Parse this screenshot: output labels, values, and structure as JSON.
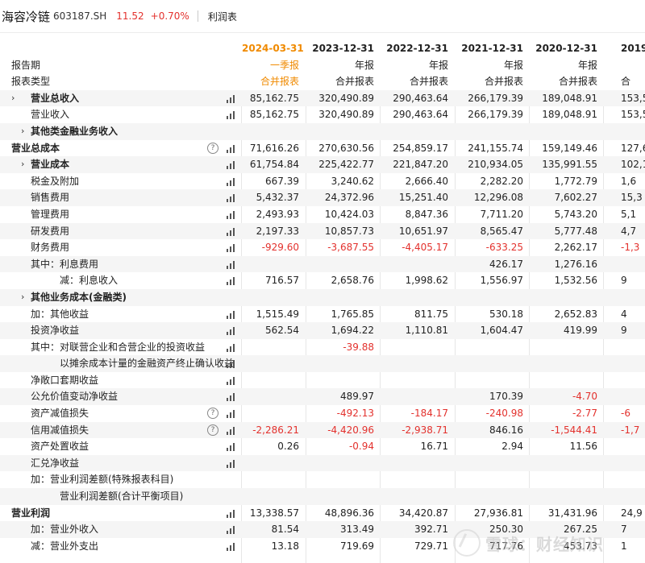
{
  "header": {
    "name": "海容冷链",
    "code": "603187.SH",
    "price": "11.52",
    "change": "+0.70%",
    "tab": "利润表"
  },
  "columns": [
    {
      "date": "2024-03-31",
      "period": "一季报",
      "type": "合并报表",
      "highlight": true
    },
    {
      "date": "2023-12-31",
      "period": "年报",
      "type": "合并报表"
    },
    {
      "date": "2022-12-31",
      "period": "年报",
      "type": "合并报表"
    },
    {
      "date": "2021-12-31",
      "period": "年报",
      "type": "合并报表"
    },
    {
      "date": "2020-12-31",
      "period": "年报",
      "type": "合并报表"
    },
    {
      "date": "2019-",
      "period": "",
      "type": "合"
    }
  ],
  "header_labels": {
    "period_label": "报告期",
    "type_label": "报表类型"
  },
  "rows": [
    {
      "label": "营业总收入",
      "indent": 1,
      "bold": true,
      "expand": true,
      "chart": true,
      "values": [
        "85,162.75",
        "320,490.89",
        "290,463.64",
        "266,179.39",
        "189,048.91",
        "153,5"
      ]
    },
    {
      "label": "营业收入",
      "indent": 2,
      "chart": true,
      "values": [
        "85,162.75",
        "320,490.89",
        "290,463.64",
        "266,179.39",
        "189,048.91",
        "153,5"
      ]
    },
    {
      "label": "其他类金融业务收入",
      "indent": 2,
      "bold": true,
      "expand": true,
      "values": [
        "",
        "",
        "",
        "",
        "",
        ""
      ]
    },
    {
      "label": "营业总成本",
      "indent": 0,
      "bold": true,
      "help": true,
      "chart": true,
      "values": [
        "71,616.26",
        "270,630.56",
        "254,859.17",
        "241,155.74",
        "159,149.46",
        "127,6"
      ]
    },
    {
      "label": "营业成本",
      "indent": 2,
      "bold": true,
      "expand": true,
      "chart": true,
      "values": [
        "61,754.84",
        "225,422.77",
        "221,847.20",
        "210,934.05",
        "135,991.55",
        "102,1"
      ]
    },
    {
      "label": "税金及附加",
      "indent": 2,
      "chart": true,
      "values": [
        "667.39",
        "3,240.62",
        "2,666.40",
        "2,282.20",
        "1,772.79",
        "1,6"
      ]
    },
    {
      "label": "销售费用",
      "indent": 2,
      "chart": true,
      "values": [
        "5,432.37",
        "24,372.96",
        "15,251.40",
        "12,296.08",
        "7,602.27",
        "15,3"
      ]
    },
    {
      "label": "管理费用",
      "indent": 2,
      "chart": true,
      "values": [
        "2,493.93",
        "10,424.03",
        "8,847.36",
        "7,711.20",
        "5,743.20",
        "5,1"
      ]
    },
    {
      "label": "研发费用",
      "indent": 2,
      "chart": true,
      "values": [
        "2,197.33",
        "10,857.73",
        "10,651.97",
        "8,565.47",
        "5,777.48",
        "4,7"
      ]
    },
    {
      "label": "财务费用",
      "indent": 2,
      "chart": true,
      "values": [
        "-929.60",
        "-3,687.55",
        "-4,405.17",
        "-633.25",
        "2,262.17",
        "-1,3"
      ]
    },
    {
      "label": "其中：利息费用",
      "indent": 2,
      "chart": true,
      "values": [
        "",
        "",
        "",
        "426.17",
        "1,276.16",
        ""
      ]
    },
    {
      "label": "减：利息收入",
      "indent": 3,
      "chart": true,
      "values": [
        "716.57",
        "2,658.76",
        "1,998.62",
        "1,556.97",
        "1,532.56",
        "9"
      ]
    },
    {
      "label": "其他业务成本(金融类)",
      "indent": 2,
      "bold": true,
      "expand": true,
      "values": [
        "",
        "",
        "",
        "",
        "",
        ""
      ]
    },
    {
      "label": "加：其他收益",
      "indent": 2,
      "chart": true,
      "values": [
        "1,515.49",
        "1,765.85",
        "811.75",
        "530.18",
        "2,652.83",
        "4"
      ]
    },
    {
      "label": "投资净收益",
      "indent": 2,
      "chart": true,
      "values": [
        "562.54",
        "1,694.22",
        "1,110.81",
        "1,604.47",
        "419.99",
        "9"
      ]
    },
    {
      "label": "其中：对联营企业和合营企业的投资收益",
      "indent": 2,
      "chart": true,
      "values": [
        "",
        "-39.88",
        "",
        "",
        "",
        ""
      ]
    },
    {
      "label": "以摊余成本计量的金融资产终止确认收益",
      "indent": 4,
      "chart": true,
      "values": [
        "",
        "",
        "",
        "",
        "",
        ""
      ]
    },
    {
      "label": "净敞口套期收益",
      "indent": 2,
      "chart": true,
      "values": [
        "",
        "",
        "",
        "",
        "",
        ""
      ]
    },
    {
      "label": "公允价值变动净收益",
      "indent": 2,
      "chart": true,
      "values": [
        "",
        "489.97",
        "",
        "170.39",
        "-4.70",
        ""
      ]
    },
    {
      "label": "资产减值损失",
      "indent": 2,
      "help": true,
      "chart": true,
      "values": [
        "",
        "-492.13",
        "-184.17",
        "-240.98",
        "-2.77",
        "-6"
      ]
    },
    {
      "label": "信用减值损失",
      "indent": 2,
      "help": true,
      "chart": true,
      "values": [
        "-2,286.21",
        "-4,420.96",
        "-2,938.71",
        "846.16",
        "-1,544.41",
        "-1,7"
      ]
    },
    {
      "label": "资产处置收益",
      "indent": 2,
      "chart": true,
      "values": [
        "0.26",
        "-0.94",
        "16.71",
        "2.94",
        "11.56",
        ""
      ]
    },
    {
      "label": "汇兑净收益",
      "indent": 2,
      "chart": true,
      "values": [
        "",
        "",
        "",
        "",
        "",
        ""
      ]
    },
    {
      "label": "加：营业利润差额(特殊报表科目)",
      "indent": 2,
      "values": [
        "",
        "",
        "",
        "",
        "",
        ""
      ]
    },
    {
      "label": "营业利润差额(合计平衡项目)",
      "indent": 3,
      "values": [
        "",
        "",
        "",
        "",
        "",
        ""
      ]
    },
    {
      "label": "营业利润",
      "indent": 0,
      "bold": true,
      "chart": true,
      "values": [
        "13,338.57",
        "48,896.36",
        "34,420.87",
        "27,936.81",
        "31,431.96",
        "24,9"
      ]
    },
    {
      "label": "加：营业外收入",
      "indent": 2,
      "chart": true,
      "values": [
        "81.54",
        "313.49",
        "392.71",
        "250.30",
        "267.25",
        "7"
      ]
    },
    {
      "label": "减：营业外支出",
      "indent": 2,
      "chart": true,
      "values": [
        "13.18",
        "719.69",
        "729.71",
        "717.76",
        "453.73",
        "1"
      ]
    }
  ],
  "watermark": {
    "text": "雪球：财经知识"
  },
  "colors": {
    "negative": "#e3312d",
    "highlight": "#f08a00",
    "row_alt": "#f5f5f5"
  }
}
